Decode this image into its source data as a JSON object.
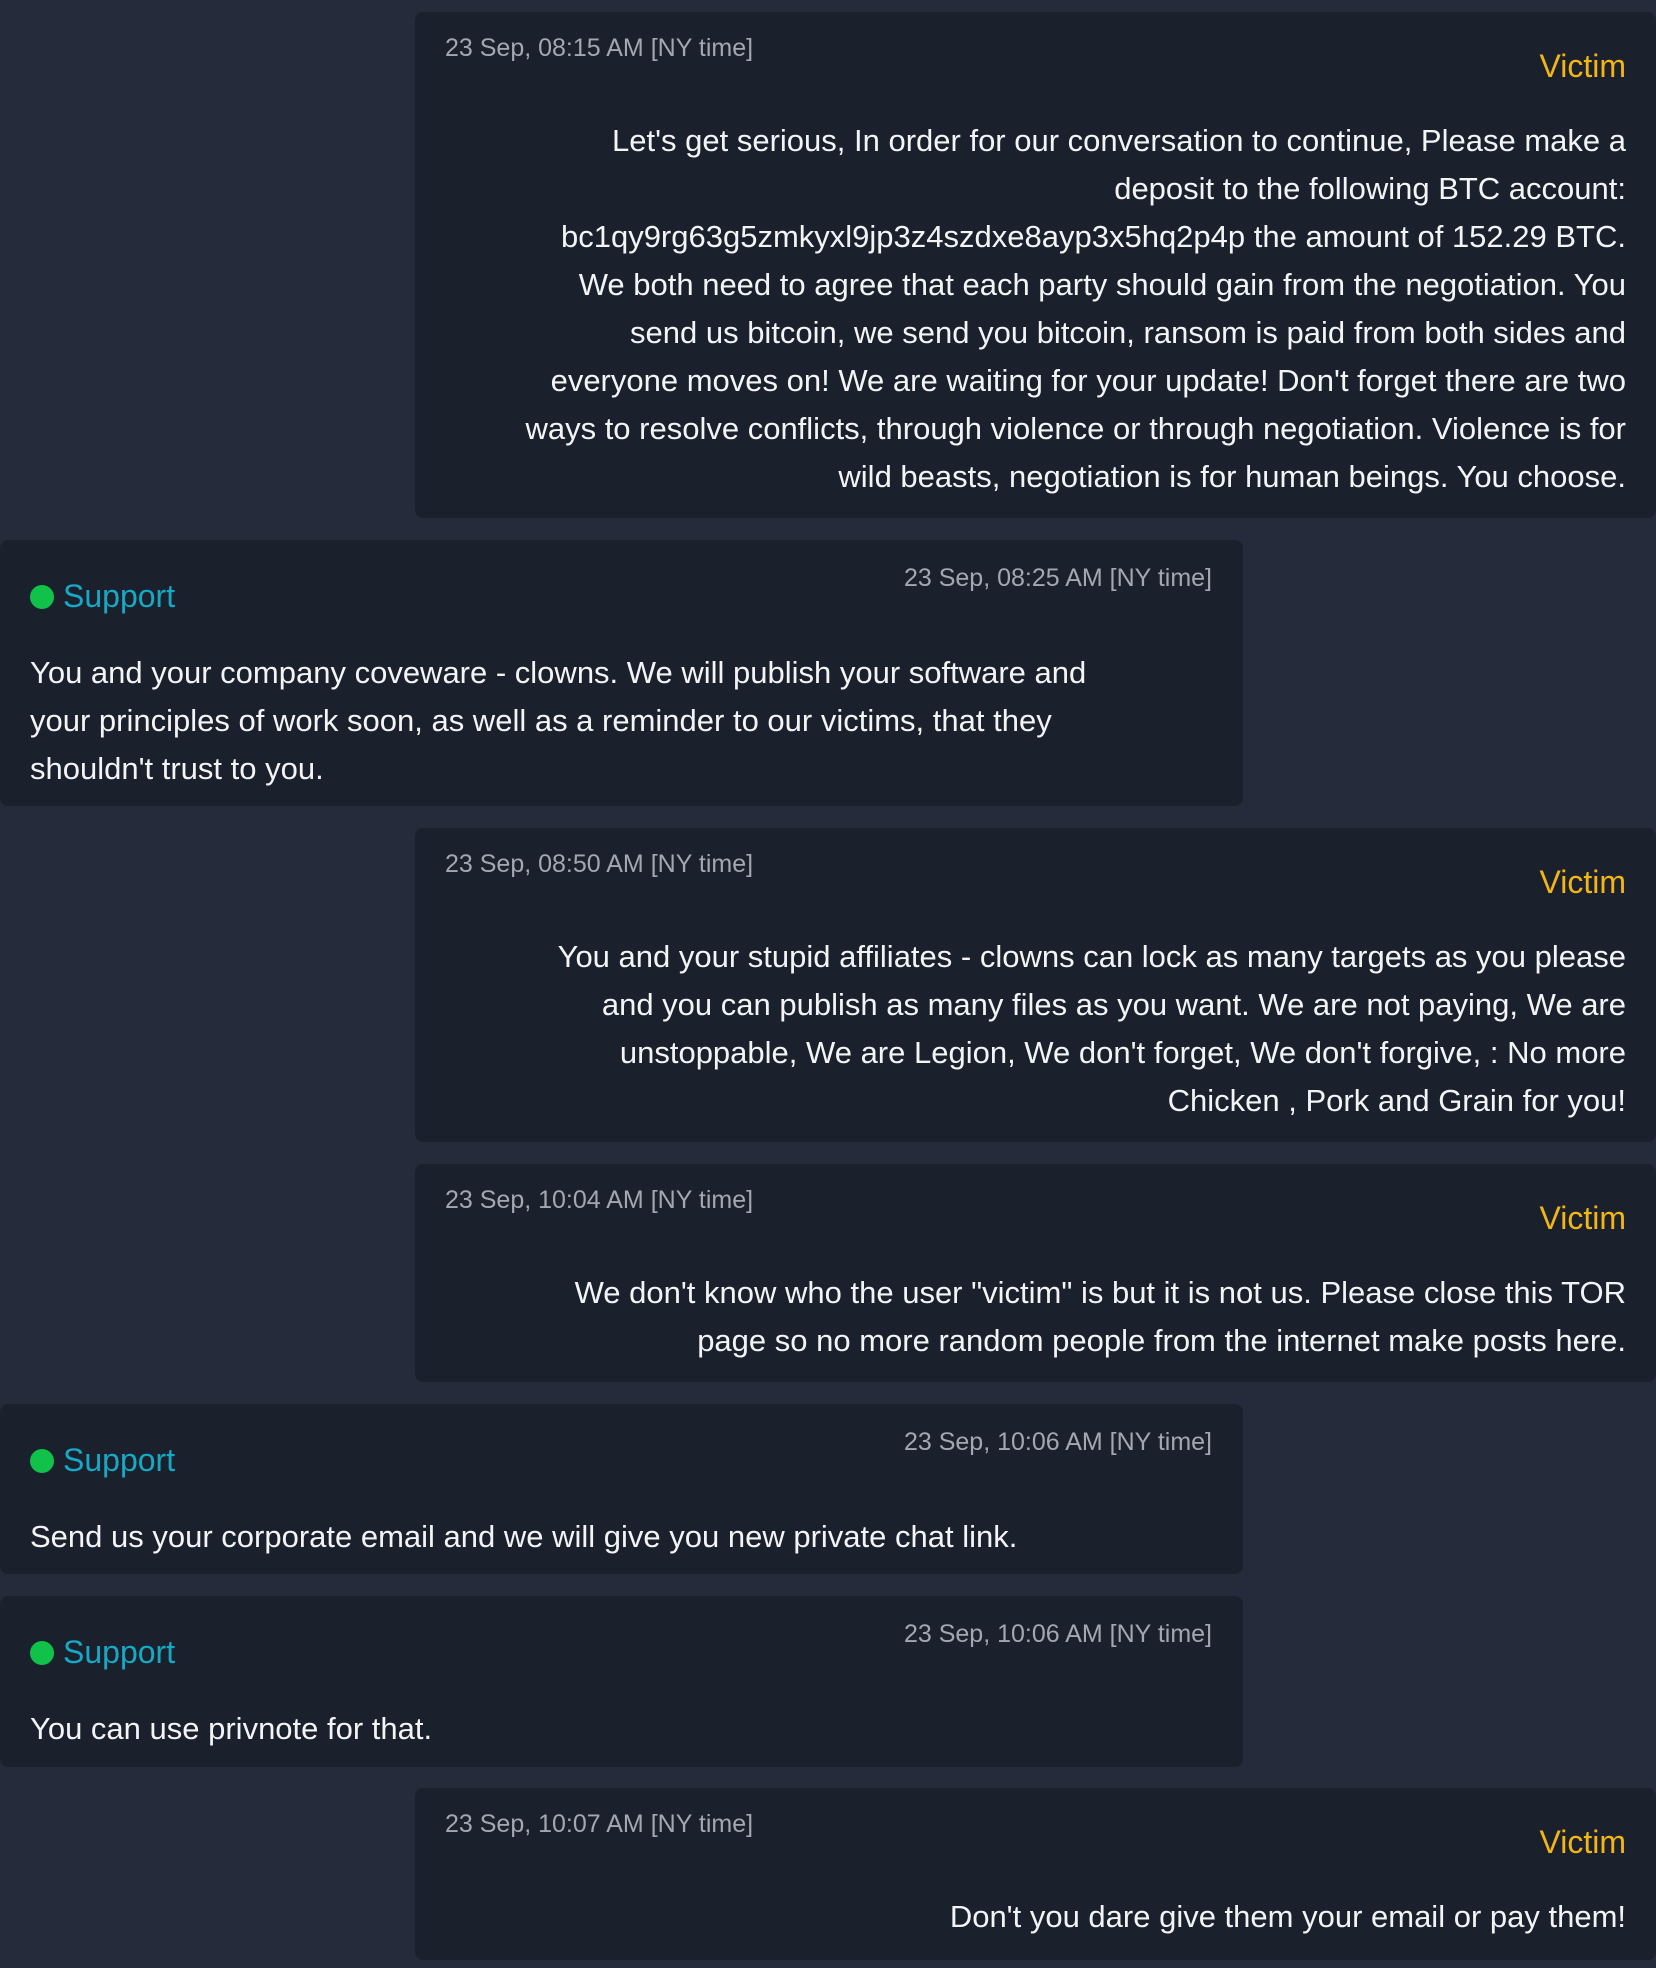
{
  "messages": [
    {
      "author": "Victim",
      "time": "23 Sep, 08:15 AM [NY time]",
      "lines": [
        "Let's get serious, In order for our conversation to continue, Please make a",
        "deposit to the following BTC account:",
        "bc1qy9rg63g5zmkyxl9jp3z4szdxe8ayp3x5hq2p4p the amount of 152.29 BTC.",
        "We both need to agree that each party should gain from the negotiation. You",
        "send us bitcoin, we send you bitcoin, ransom is paid from both sides and",
        "everyone moves on! We are waiting for your update! Don't forget there are two",
        "ways to resolve conflicts, through violence or through negotiation. Violence is for",
        "wild beasts, negotiation is for human beings. You choose."
      ]
    },
    {
      "author": "Support",
      "time": "23 Sep, 08:25 AM [NY time]",
      "lines": [
        "You and your company coveware - clowns. We will publish your software and",
        "your principles of work soon, as well as a reminder to our victims, that they",
        "shouldn't trust to you."
      ]
    },
    {
      "author": "Victim",
      "time": "23 Sep, 08:50 AM [NY time]",
      "lines": [
        "You and your stupid affiliates - clowns can lock as many targets as you please",
        "and you can publish as many files as you want. We are not paying, We are",
        "unstoppable, We are Legion, We don't forget, We don't forgive, : No more",
        "Chicken , Pork and Grain for you!"
      ]
    },
    {
      "author": "Victim",
      "time": "23 Sep, 10:04 AM [NY time]",
      "lines": [
        "We don't know who the user \"victim\" is but it is not us. Please close this TOR",
        "page so no more random people from the internet make posts here."
      ]
    },
    {
      "author": "Support",
      "time": "23 Sep, 10:06 AM [NY time]",
      "lines": [
        "Send us your corporate email and we will give you new private chat link."
      ]
    },
    {
      "author": "Support",
      "time": "23 Sep, 10:06 AM [NY time]",
      "lines": [
        "You can use privnote for that."
      ]
    },
    {
      "author": "Victim",
      "time": "23 Sep, 10:07 AM [NY time]",
      "lines": [
        "Don't you dare give them your email or pay them!"
      ]
    }
  ],
  "colors": {
    "page_background": "#262b3b",
    "bubble_background": "#1b202d",
    "victim_name": "#f3b613",
    "support_name": "#16a8c4",
    "online_dot": "#10c24a"
  }
}
